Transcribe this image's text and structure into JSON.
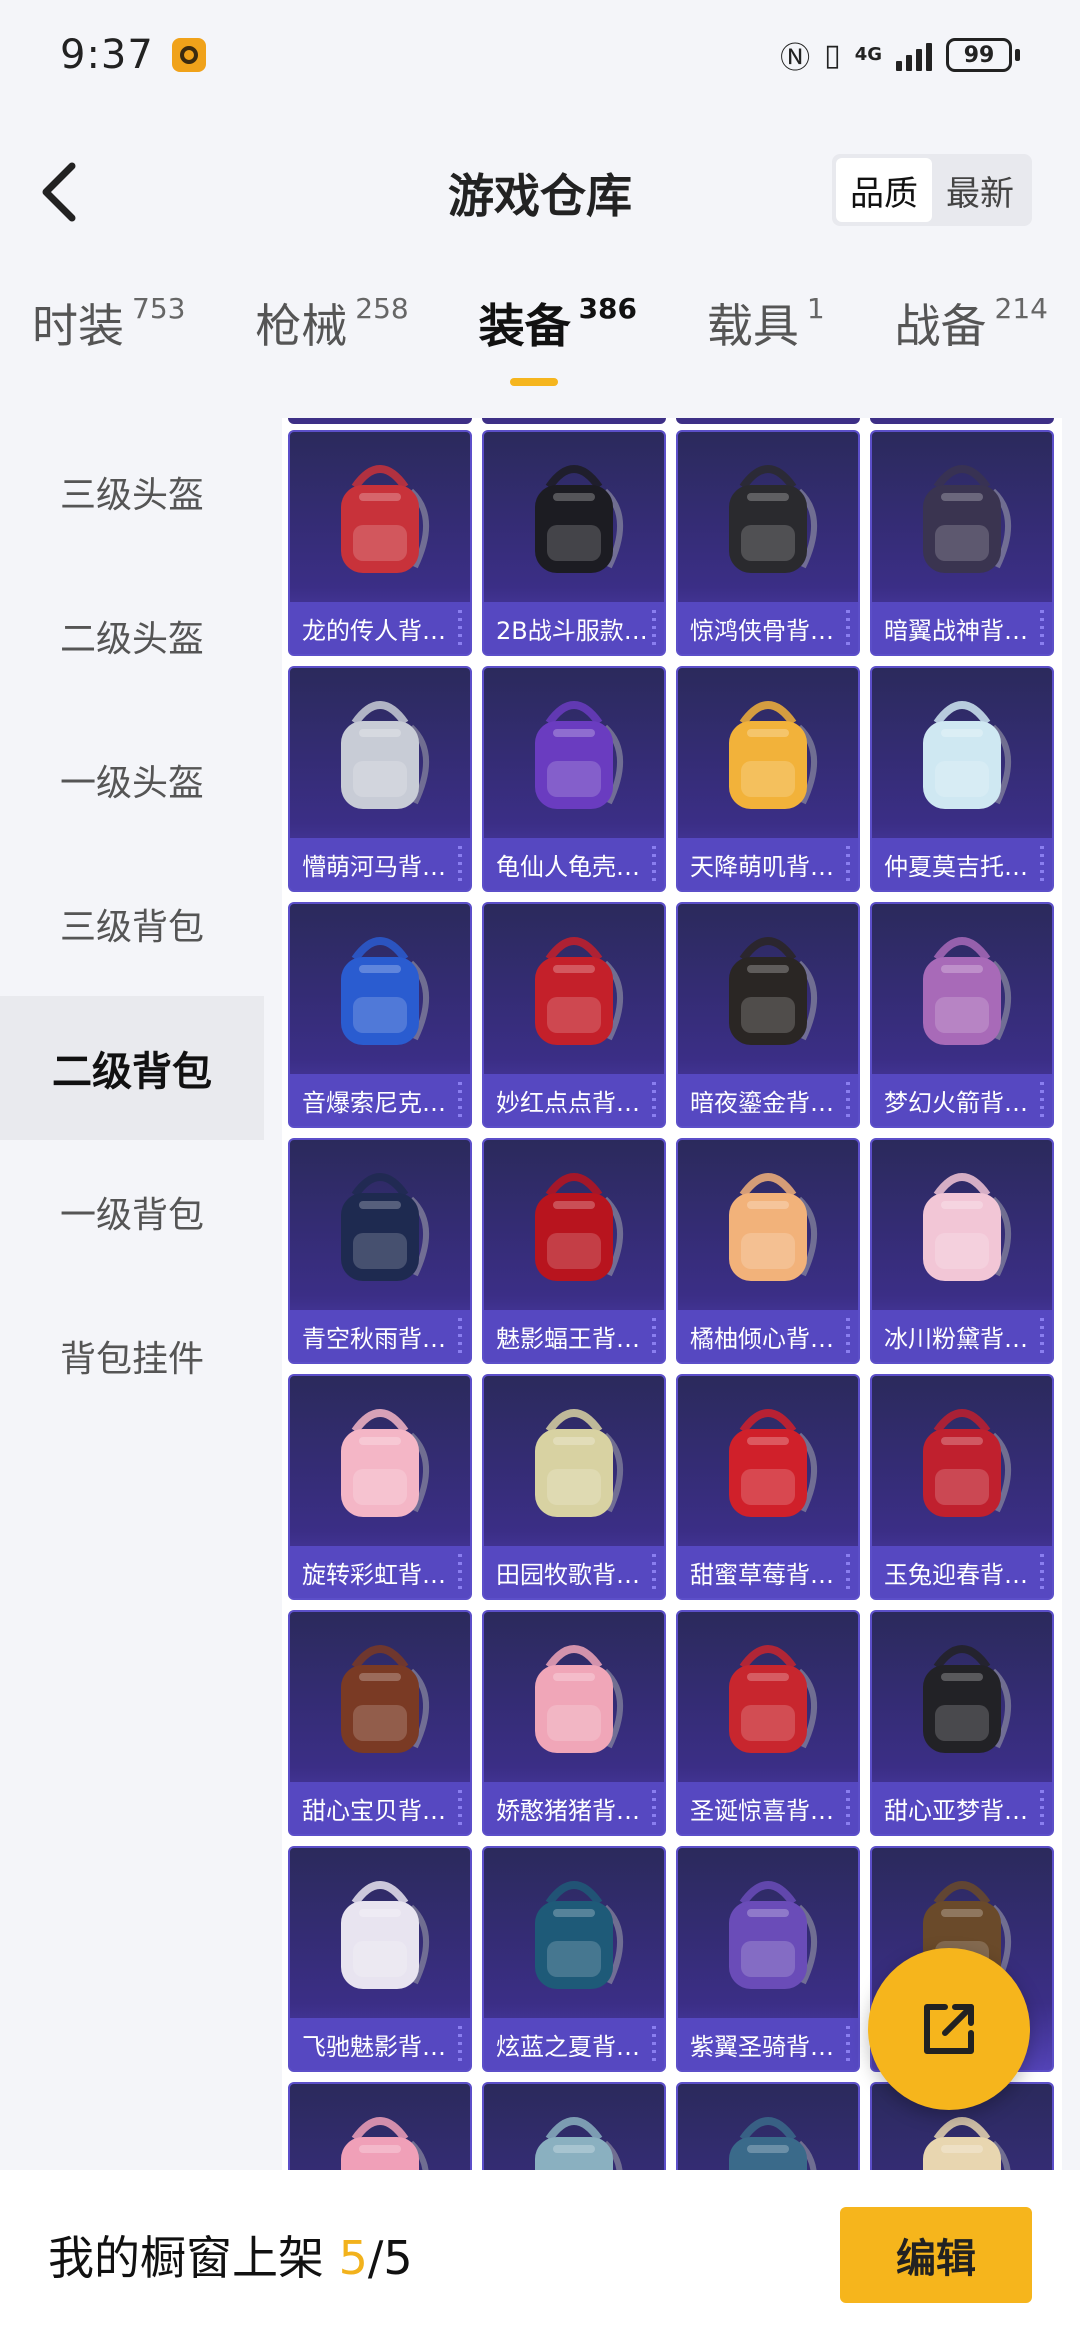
{
  "status_bar": {
    "time": "9:37",
    "network": "4G",
    "battery": "99"
  },
  "header": {
    "title": "游戏仓库",
    "sort_options": [
      "品质",
      "最新"
    ],
    "sort_selected": "品质"
  },
  "category_tabs": [
    {
      "label": "时装",
      "count": "753"
    },
    {
      "label": "枪械",
      "count": "258"
    },
    {
      "label": "装备",
      "count": "386",
      "active": true
    },
    {
      "label": "载具",
      "count": "1"
    },
    {
      "label": "战备",
      "count": "214"
    }
  ],
  "side_menu": [
    {
      "label": "三级头盔"
    },
    {
      "label": "二级头盔"
    },
    {
      "label": "一级头盔"
    },
    {
      "label": "三级背包"
    },
    {
      "label": "二级背包",
      "active": true
    },
    {
      "label": "一级背包"
    },
    {
      "label": "背包挂件"
    }
  ],
  "items": [
    {
      "name": "龙的传人背…",
      "color": "#c8323a"
    },
    {
      "name": "2B战斗服款…",
      "color": "#1c1c22"
    },
    {
      "name": "惊鸿侠骨背…",
      "color": "#2a2a2e"
    },
    {
      "name": "暗翼战神背…",
      "color": "#3a3450"
    },
    {
      "name": "懵萌河马背…",
      "color": "#c8ccd6"
    },
    {
      "name": "龟仙人龟壳…",
      "color": "#6a3cc0"
    },
    {
      "name": "天降萌叽背…",
      "color": "#f2b23a"
    },
    {
      "name": "仲夏莫吉托…",
      "color": "#cfe8f2"
    },
    {
      "name": "音爆索尼克…",
      "color": "#2a5cd0"
    },
    {
      "name": "妙红点点背…",
      "color": "#c4202a"
    },
    {
      "name": "暗夜鎏金背…",
      "color": "#2a2624"
    },
    {
      "name": "梦幻火箭背…",
      "color": "#a86ab8"
    },
    {
      "name": "青空秋雨背…",
      "color": "#1e2a50"
    },
    {
      "name": "魅影蝠王背…",
      "color": "#b8141e"
    },
    {
      "name": "橘柚倾心背…",
      "color": "#f2b27a"
    },
    {
      "name": "冰川粉黛背…",
      "color": "#f2c6d6"
    },
    {
      "name": "旋转彩虹背…",
      "color": "#f4b6c6"
    },
    {
      "name": "田园牧歌背…",
      "color": "#d8d2a2"
    },
    {
      "name": "甜蜜草莓背…",
      "color": "#d0202a"
    },
    {
      "name": "玉兔迎春背…",
      "color": "#c0202e"
    },
    {
      "name": "甜心宝贝背…",
      "color": "#7a3a24"
    },
    {
      "name": "娇憨猪猪背…",
      "color": "#f0a6b8"
    },
    {
      "name": "圣诞惊喜背…",
      "color": "#c8262e"
    },
    {
      "name": "甜心亚梦背…",
      "color": "#222226"
    },
    {
      "name": "飞驰魅影背…",
      "color": "#e8e4f0"
    },
    {
      "name": "炫蓝之夏背…",
      "color": "#1e5a78"
    },
    {
      "name": "紫翼圣骑背…",
      "color": "#6a4cb8"
    },
    {
      "name": "",
      "color": "#6a4a2a"
    },
    {
      "name": "",
      "color": "#f0a0b8"
    },
    {
      "name": "",
      "color": "#8ab0c0"
    },
    {
      "name": "",
      "color": "#3a6a8a"
    },
    {
      "name": "",
      "color": "#e8d6b0"
    }
  ],
  "bottom_bar": {
    "label": "我的橱窗上架",
    "current": "5",
    "separator": "/",
    "total": "5",
    "edit_label": "编辑"
  },
  "colors": {
    "accent": "#f6b51c",
    "card_bg": "#3b2e86",
    "card_label_bg": "#5648c1"
  }
}
